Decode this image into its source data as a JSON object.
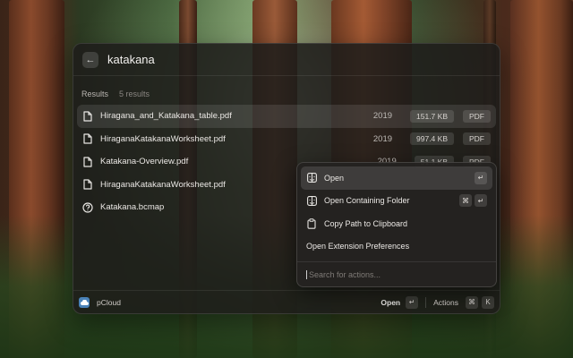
{
  "search": {
    "query": "katakana"
  },
  "section": {
    "title": "Results",
    "count": "5 results"
  },
  "results": [
    {
      "name": "Hiragana_and_Katakana_table.pdf",
      "year": "2019",
      "size": "151.7 KB",
      "type": "PDF",
      "icon": "document-icon",
      "selected": true
    },
    {
      "name": "HiraganaKatakanaWorksheet.pdf",
      "year": "2019",
      "size": "997.4 KB",
      "type": "PDF",
      "icon": "document-icon"
    },
    {
      "name": "Katakana-Overview.pdf",
      "year": "2019",
      "size": "51.1 KB",
      "type": "PDF",
      "icon": "document-icon"
    },
    {
      "name": "HiraganaKatakanaWorksheet.pdf",
      "year": "",
      "size": "",
      "type": "",
      "icon": "document-icon"
    },
    {
      "name": "Katakana.bcmap",
      "year": "",
      "size": "",
      "type": "",
      "icon": "question-icon"
    }
  ],
  "footer": {
    "extension": "pCloud",
    "primary_action": "Open",
    "primary_key": "↵",
    "actions_label": "Actions",
    "actions_keys": [
      "⌘",
      "K"
    ]
  },
  "action_panel": {
    "items": [
      {
        "label": "Open",
        "icon": "finder-icon",
        "keys": [
          "↵"
        ]
      },
      {
        "label": "Open Containing Folder",
        "icon": "finder-icon",
        "keys": [
          "⌘",
          "↵"
        ]
      },
      {
        "label": "Copy Path to Clipboard",
        "icon": "clipboard-icon",
        "keys": []
      },
      {
        "label": "Open Extension Preferences",
        "icon": "",
        "keys": []
      }
    ],
    "search_placeholder": "Search for actions..."
  },
  "colors": {
    "window_bg": "#1e1c1a",
    "extension_accent": "#4a82b8"
  }
}
